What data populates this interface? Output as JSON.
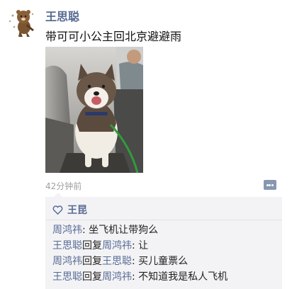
{
  "post": {
    "author": "王思聪",
    "text": "带可可小公主回北京避避雨",
    "time": "42分钟前"
  },
  "likes": {
    "names": "王昆"
  },
  "comments": [
    {
      "from": "周鸿祎",
      "reply_word": "",
      "to": "",
      "sep": ": ",
      "text": "坐飞机让带狗么"
    },
    {
      "from": "王思聪",
      "reply_word": "回复",
      "to": "周鸿祎",
      "sep": ": ",
      "text": "让"
    },
    {
      "from": "周鸿祎",
      "reply_word": "回复",
      "to": "王思聪",
      "sep": ": ",
      "text": "买儿童票么"
    },
    {
      "from": "王思聪",
      "reply_word": "回复",
      "to": "周鸿祎",
      "sep": ": ",
      "text": "不知道我是私人飞机"
    }
  ],
  "colors": {
    "name_link": "#576b95",
    "comment_bg": "#f3f3f5"
  },
  "icons": {
    "avatar": "cartoon-bear-avatar",
    "like": "heart-outline-icon",
    "more": "more-options-icon"
  }
}
